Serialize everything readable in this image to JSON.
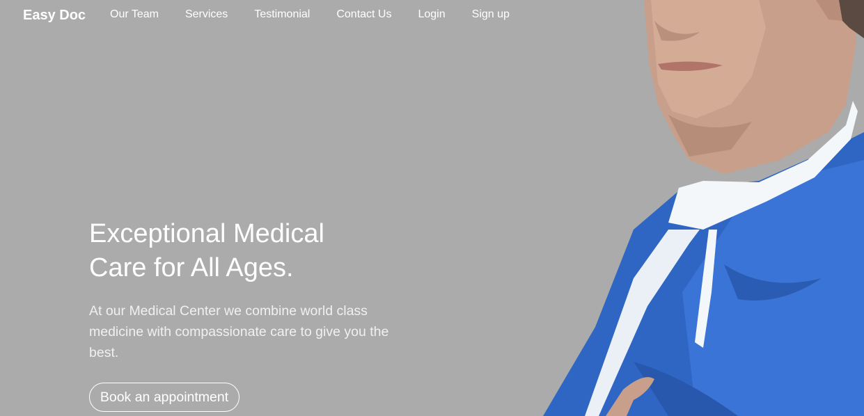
{
  "navbar": {
    "brand": "Easy Doc",
    "items": [
      {
        "label": "Our Team"
      },
      {
        "label": "Services"
      },
      {
        "label": "Testimonial"
      },
      {
        "label": "Contact Us"
      },
      {
        "label": "Login"
      },
      {
        "label": "Sign up"
      }
    ]
  },
  "hero": {
    "title_line1": "Exceptional Medical",
    "title_line2": "Care for All Ages.",
    "subtitle": "At our Medical Center we combine world class medicine with compassionate care to give you the best.",
    "cta_label": "Book an appointment"
  },
  "colors": {
    "background": "#ababab",
    "text": "#ffffff",
    "scrubs": "#2f66c4"
  }
}
